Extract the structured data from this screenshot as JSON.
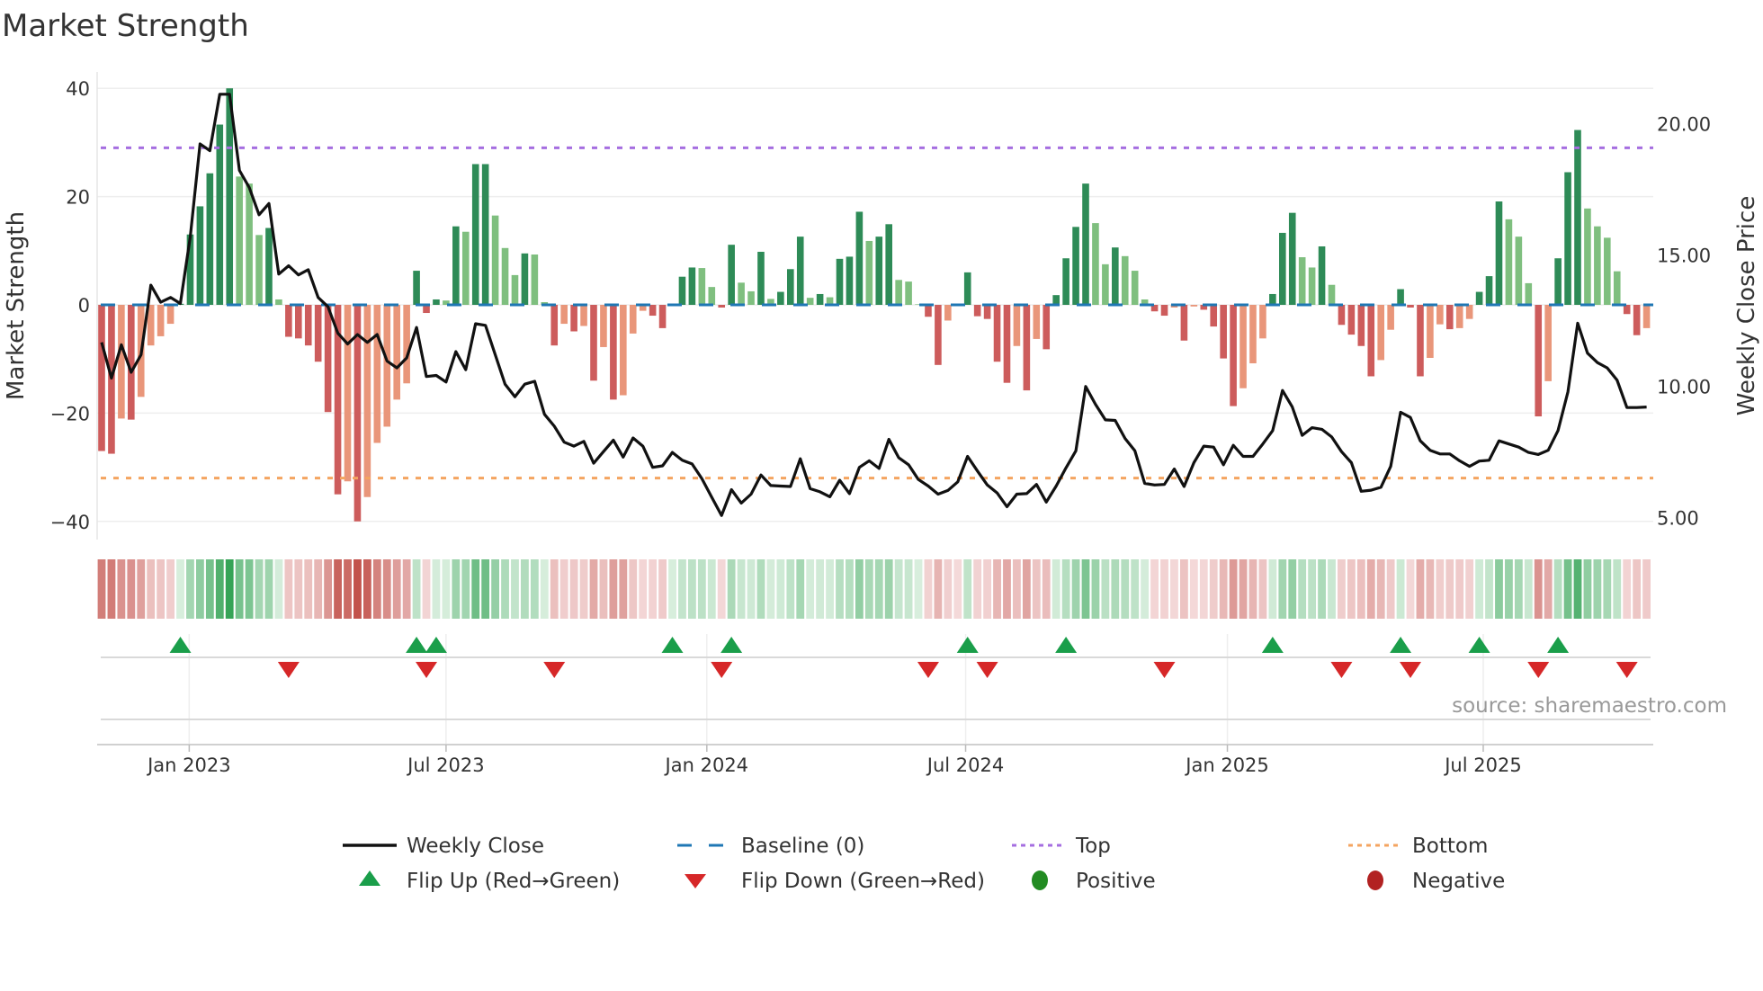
{
  "chart_data": {
    "type": "bar",
    "title": "Market Strength",
    "ylabel": "Market Strength",
    "y2label": "Weekly Close Price",
    "ylim": [
      -43,
      43
    ],
    "y2lim": [
      4.4,
      22.4
    ],
    "yticks": [
      40,
      20,
      0,
      -20,
      -40
    ],
    "yticklabels": [
      "40",
      "20",
      "0",
      "−20",
      "−40"
    ],
    "y2ticks": [
      20,
      15,
      10,
      5
    ],
    "y2ticklabels": [
      "20.00",
      "15.00",
      "10.00",
      "5.00"
    ],
    "x_unit": "week index (weekly bars)",
    "xticks": [
      {
        "label": "Jan 2023",
        "week": 8.9
      },
      {
        "label": "Jul 2023",
        "week": 35.0
      },
      {
        "label": "Jan 2024",
        "week": 61.5
      },
      {
        "label": "Jul 2024",
        "week": 87.8
      },
      {
        "label": "Jan 2025",
        "week": 114.4
      },
      {
        "label": "Jul 2025",
        "week": 140.4
      }
    ],
    "top_level": 29,
    "bottom_level": -32,
    "baseline": 0,
    "strength": [
      -27,
      -27.5,
      -21,
      -21.2,
      -17,
      -7.5,
      -5.8,
      -3.5,
      0.2,
      13,
      18.2,
      24.3,
      33.3,
      40,
      23.7,
      22.4,
      12.9,
      14.2,
      1,
      -5.9,
      -6.2,
      -7.5,
      -10.5,
      -19.8,
      -35,
      -32.6,
      -40,
      -35.5,
      -25.5,
      -22.5,
      -17.5,
      -14.5,
      6.3,
      -1.5,
      1,
      0.8,
      14.5,
      13.5,
      26,
      26,
      16.5,
      10.5,
      5.5,
      9.5,
      9.3,
      0.5,
      -7.5,
      -3.5,
      -4.9,
      -3.9,
      -14,
      -7.8,
      -17.5,
      -16.7,
      -5.3,
      -1.1,
      -2,
      -4.3,
      0.2,
      5.2,
      6.9,
      6.8,
      3.3,
      -0.5,
      11.1,
      4.1,
      2.5,
      9.8,
      1.1,
      2.4,
      6.6,
      12.6,
      1.3,
      2,
      1.4,
      8.5,
      8.9,
      17.2,
      11.8,
      12.6,
      14.9,
      4.6,
      4.3,
      0.1,
      -2.2,
      -11.1,
      -2.9,
      -0.1,
      6,
      -2.1,
      -2.6,
      -10.5,
      -14.4,
      -7.6,
      -15.8,
      -6.3,
      -8.2,
      1.8,
      8.6,
      14.4,
      22.4,
      15.1,
      7.5,
      10.6,
      9,
      6.3,
      1,
      -1.2,
      -2,
      -0.5,
      -6.6,
      -0.3,
      -0.9,
      -4,
      -9.9,
      -18.7,
      -15.4,
      -10.8,
      -6.2,
      2,
      13.3,
      17,
      8.8,
      6.9,
      10.8,
      3.7,
      -3.7,
      -5.5,
      -7.6,
      -13.2,
      -10.2,
      -4.6,
      2.9,
      -0.5,
      -13.2,
      -9.8,
      -3.6,
      -4.5,
      -4.3,
      -2.6,
      2.4,
      5.3,
      19.1,
      15.8,
      12.6,
      4,
      -20.6,
      -14.1,
      8.6,
      24.5,
      32.3,
      17.8,
      14.5,
      12.4,
      6.2,
      -1.7,
      -5.6,
      -4.3
    ],
    "weekly_close": [
      11.67,
      10.31,
      11.58,
      10.53,
      11.2,
      13.85,
      13.2,
      13.38,
      13.15,
      15.68,
      19.23,
      18.97,
      21.12,
      21.12,
      18.22,
      17.57,
      16.53,
      16.96,
      14.27,
      14.59,
      14.24,
      14.44,
      13.38,
      13.03,
      12.02,
      11.61,
      11.97,
      11.67,
      11.97,
      10.96,
      10.7,
      11.08,
      12.24,
      10.37,
      10.41,
      10.16,
      11.32,
      10.63,
      12.38,
      12.32,
      11.2,
      10.08,
      9.6,
      10.08,
      10.19,
      8.93,
      8.48,
      7.87,
      7.72,
      7.9,
      7.07,
      7.51,
      7.95,
      7.3,
      8.03,
      7.72,
      6.91,
      6.97,
      7.48,
      7.18,
      7.04,
      6.48,
      5.77,
      5.08,
      6.06,
      5.55,
      5.89,
      6.62,
      6.22,
      6.2,
      6.18,
      7.24,
      6.1,
      5.98,
      5.79,
      6.42,
      5.91,
      6.91,
      7.16,
      6.87,
      7.98,
      7.28,
      7.01,
      6.45,
      6.2,
      5.89,
      6.03,
      6.36,
      7.33,
      6.77,
      6.24,
      5.94,
      5.41,
      5.89,
      5.91,
      6.26,
      5.59,
      6.2,
      6.89,
      7.54,
      9.99,
      9.31,
      8.72,
      8.7,
      8.01,
      7.54,
      6.3,
      6.24,
      6.26,
      6.85,
      6.18,
      7.09,
      7.72,
      7.68,
      7.01,
      7.75,
      7.33,
      7.33,
      7.8,
      8.31,
      9.84,
      9.21,
      8.13,
      8.42,
      8.36,
      8.07,
      7.51,
      7.09,
      6.0,
      6.04,
      6.15,
      6.95,
      9.01,
      8.81,
      7.92,
      7.56,
      7.42,
      7.42,
      7.16,
      6.95,
      7.15,
      7.18,
      7.92,
      7.8,
      7.68,
      7.48,
      7.4,
      7.56,
      8.31,
      9.78,
      12.4,
      11.26,
      10.9,
      10.7,
      10.23,
      9.19,
      9.19,
      9.21
    ],
    "flip_up_weeks": [
      8,
      32,
      34,
      58,
      64,
      88,
      98,
      119,
      132,
      140,
      148
    ],
    "flip_down_weeks": [
      19,
      33,
      46,
      63,
      84,
      90,
      108,
      126,
      133,
      146,
      155
    ],
    "legend": {
      "weekly_close": "Weekly Close",
      "baseline": "Baseline (0)",
      "top": "Top",
      "bottom": "Bottom",
      "flip_up": "Flip Up (Red→Green)",
      "flip_down": "Flip Down (Green→Red)",
      "positive": "Positive",
      "negative": "Negative"
    },
    "legend_placement": "bottom",
    "source": "source: sharemaestro.com",
    "colors": {
      "pos_rising": "#2e8b57",
      "pos_falling": "#7fbf7f",
      "neg_rising": "#cd5c5c",
      "neg_falling": "#e9967a",
      "line": "#111111",
      "baseline": "#1f77b4",
      "top": "#a56ee0",
      "bottom": "#f4a460",
      "flip_up": "#1a9e4a",
      "flip_down": "#d62728",
      "positive": "#228b22",
      "negative": "#b22222"
    }
  }
}
